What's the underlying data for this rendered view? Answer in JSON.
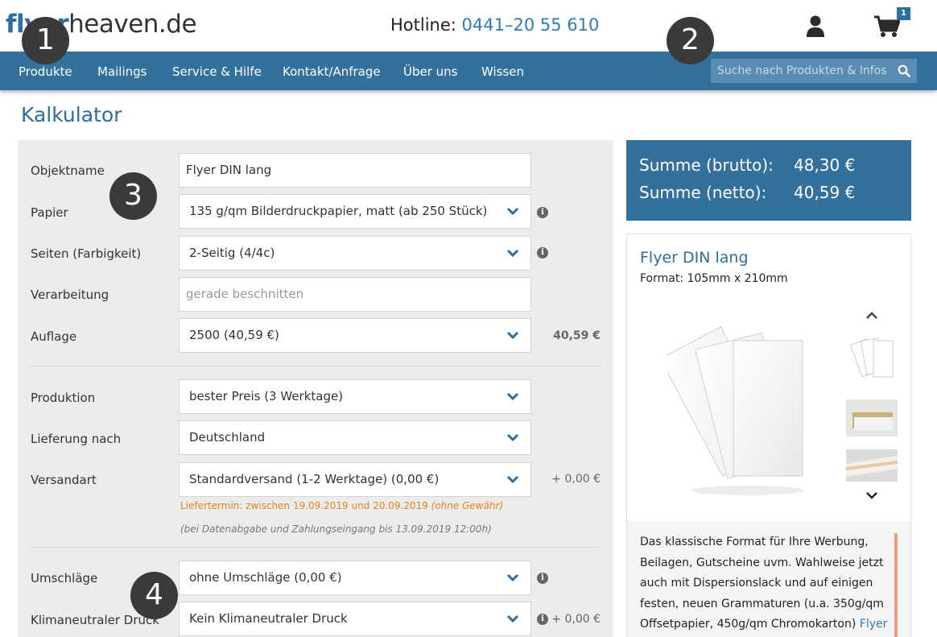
{
  "header": {
    "logo_brand": "flyer",
    "logo_rest": "heaven.de",
    "hotline_label": "Hotline:",
    "hotline_number": "0441–20 55 610",
    "cart_count": "1"
  },
  "nav": {
    "items": [
      "Produkte",
      "Mailings",
      "Service & Hilfe",
      "Kontakt/Anfrage",
      "Über uns",
      "Wissen"
    ],
    "search_placeholder": "Suche nach Produkten & Infos"
  },
  "page": {
    "title": "Kalkulator"
  },
  "calculator": {
    "objektname": {
      "label": "Objektname",
      "value": "Flyer DIN lang"
    },
    "papier": {
      "label": "Papier",
      "value": "135 g/qm Bilderdruckpapier, matt (ab 250 Stück)"
    },
    "seiten": {
      "label": "Seiten (Farbigkeit)",
      "value": "2-Seitig (4/4c)"
    },
    "verarbeitung": {
      "label": "Verarbeitung",
      "placeholder": "gerade beschnitten"
    },
    "auflage": {
      "label": "Auflage",
      "value": "2500 (40,59 €)",
      "price": "40,59 €"
    },
    "produktion": {
      "label": "Produktion",
      "value": "bester Preis (3 Werktage)"
    },
    "lieferung": {
      "label": "Lieferung nach",
      "value": "Deutschland"
    },
    "versandart": {
      "label": "Versandart",
      "value": "Standardversand (1-2 Werktage) (0,00 €)",
      "price": "+ 0,00 €"
    },
    "liefertermin": "Liefertermin: zwischen 19.09.2019 und 20.09.2019",
    "liefertermin_note": "(ohne Gewähr)",
    "abgabe_note": "(bei Datenabgabe und Zahlungseingang bis 13.09.2019 12:00h)",
    "umschlaege": {
      "label": "Umschläge",
      "value": "ohne Umschläge (0,00 €)"
    },
    "klima": {
      "label": "Klimaneutraler Druck",
      "value": "Kein Klimaneutraler Druck",
      "price": "+ 0,00 €"
    }
  },
  "summary": {
    "brutto_label": "Summe (brutto):",
    "brutto_value": "48,30 €",
    "netto_label": "Summe (netto):",
    "netto_value": "40,59 €"
  },
  "product": {
    "title": "Flyer DIN lang",
    "format": "Format: 105mm x 210mm",
    "description": "Das klassische Format für Ihre Werbung, Beilagen, Gutscheine uvm. Wahlweise jetzt auch mit Dispersionslack und auf einigen festen, neuen Grammaturen (u.a. 350g/qm Offsetpapier, 450g/qm Chromokarton)",
    "description_link": "Flyer"
  },
  "markers": [
    "1",
    "2",
    "3",
    "4"
  ],
  "colors": {
    "brand_blue": "#33709c",
    "link_blue": "#2e7bb6",
    "delivery_orange": "#e8831f"
  }
}
